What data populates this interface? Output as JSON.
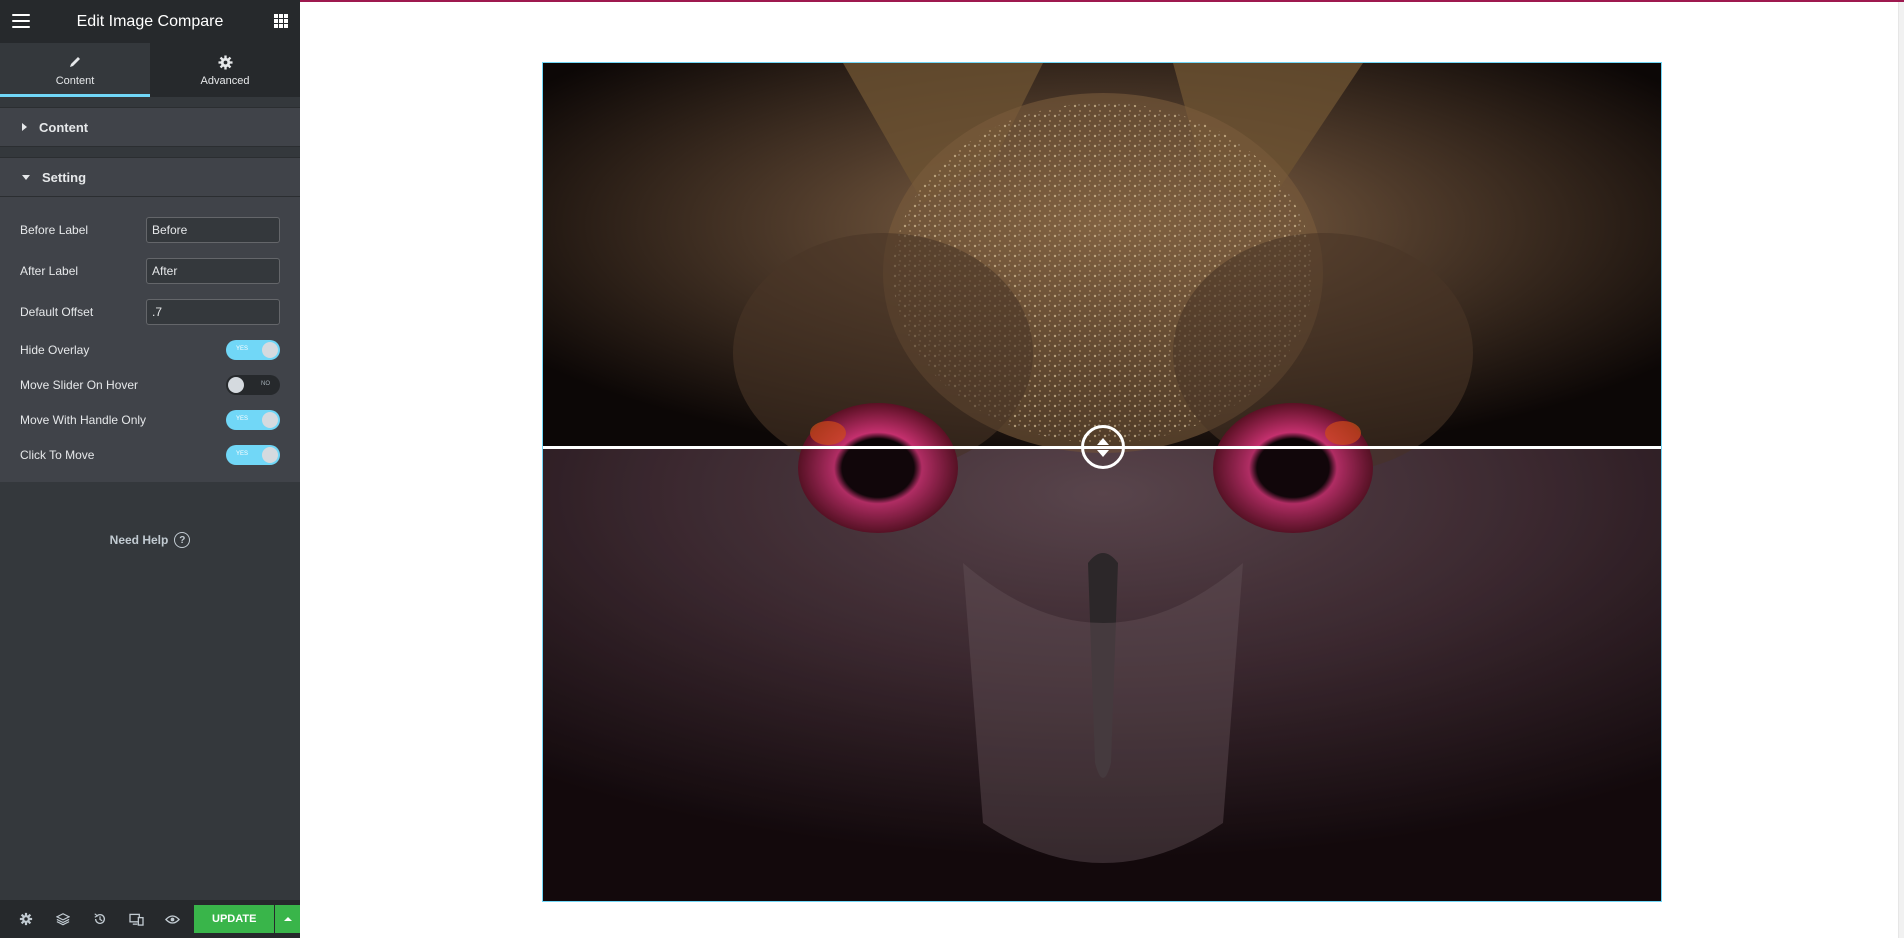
{
  "panel": {
    "title": "Edit Image Compare",
    "tabs": [
      {
        "label": "Content",
        "icon": "pencil-icon",
        "active": true
      },
      {
        "label": "Advanced",
        "icon": "gear-icon",
        "active": false
      }
    ],
    "sections": {
      "content": "Content",
      "setting": "Setting"
    },
    "fields": {
      "before_label": {
        "label": "Before Label",
        "value": "Before"
      },
      "after_label": {
        "label": "After Label",
        "value": "After"
      },
      "default_offset": {
        "label": "Default Offset",
        "value": ".7"
      }
    },
    "toggles": {
      "hide_overlay": {
        "label": "Hide Overlay",
        "state": "YES",
        "on": true
      },
      "move_slider_on_hover": {
        "label": "Move Slider On Hover",
        "state": "NO",
        "on": false
      },
      "move_with_handle_only": {
        "label": "Move With Handle Only",
        "state": "YES",
        "on": true
      },
      "click_to_move": {
        "label": "Click To Move",
        "state": "YES",
        "on": true
      }
    },
    "help": "Need Help",
    "help_icon": "?"
  },
  "footer": {
    "icons": [
      "settings-icon",
      "layers-icon",
      "history-icon",
      "responsive-icon",
      "preview-eye-icon"
    ],
    "update_label": "UPDATE"
  },
  "colors": {
    "panel_bg": "#34383c",
    "header_bg": "#26292c",
    "accent_blue": "#71d7f7",
    "update_green": "#39b54a",
    "top_accent": "#93003c"
  },
  "preview": {
    "widget": "image-compare",
    "orientation": "vertical",
    "slider_position": 0.46
  }
}
